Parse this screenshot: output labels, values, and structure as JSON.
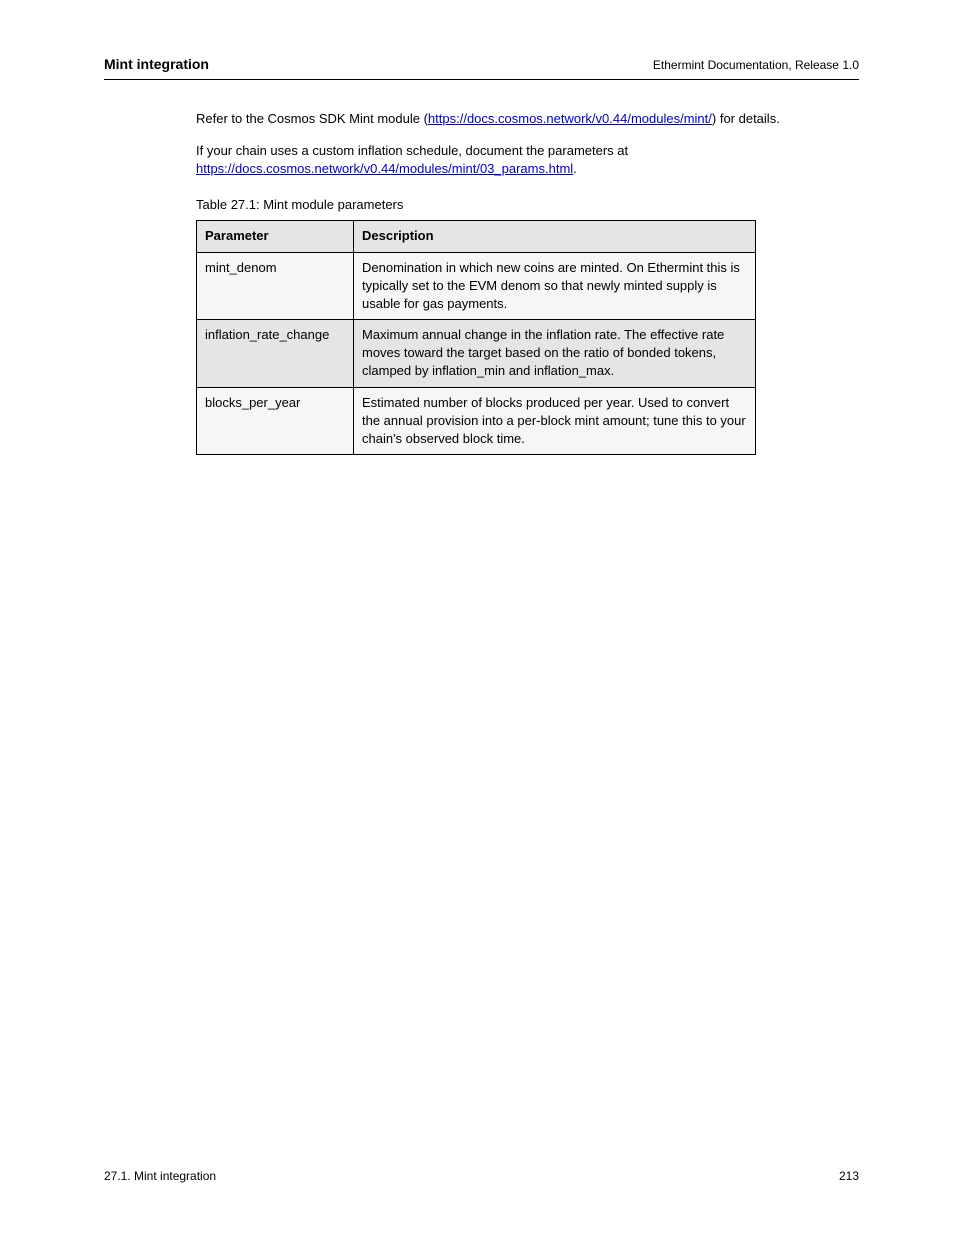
{
  "header": {
    "left": "Mint integration",
    "right": "Ethermint Documentation, Release 1.0"
  },
  "body": {
    "intro_before_link": "Refer to the Cosmos SDK Mint module (",
    "intro_link_text": "https://docs.cosmos.network/v0.44/modules/mint/",
    "intro_after_link": ") for details.",
    "note_before_link": "If your chain uses a custom inflation schedule, document the parameters at ",
    "note_link_text": "https://docs.cosmos.network/v0.44/modules/mint/03_params.html",
    "note_after_link": "."
  },
  "table": {
    "caption": "Table 27.1: Mint module parameters",
    "headers": {
      "param": "Parameter",
      "desc": "Description"
    },
    "rows": [
      {
        "param": "mint_denom",
        "desc": "Denomination in which new coins are minted. On Ethermint this is typically set to the EVM denom so that newly minted supply is usable for gas payments."
      },
      {
        "param": "inflation_rate_change",
        "desc": "Maximum annual change in the inflation rate. The effective rate moves toward the target based on the ratio of bonded tokens, clamped by inflation_min and inflation_max."
      },
      {
        "param": "blocks_per_year",
        "desc": "Estimated number of blocks produced per year. Used to convert the annual provision into a per-block mint amount; tune this to your chain's observed block time."
      }
    ]
  },
  "footer": {
    "left": "27.1. Mint integration",
    "right": "213"
  }
}
